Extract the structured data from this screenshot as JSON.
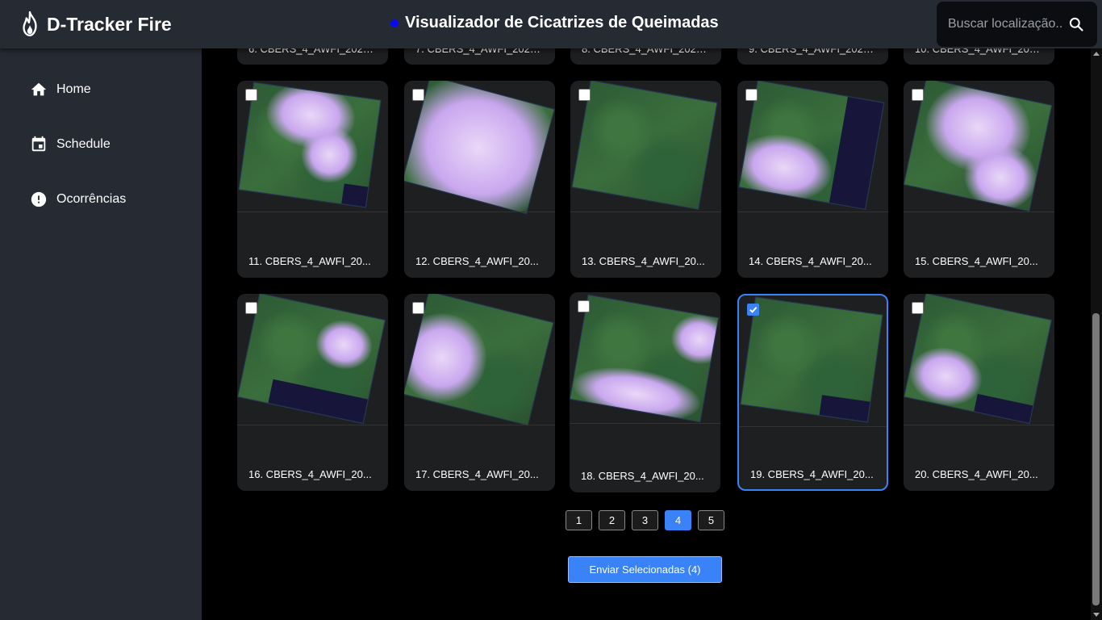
{
  "app": {
    "title": "D-Tracker Fire"
  },
  "header": {
    "page_title": "Visualizador de Cicatrizes de Queimadas",
    "status_dot_color": "#0a0af0"
  },
  "search": {
    "placeholder": "Buscar localização...",
    "value": ""
  },
  "sidebar": {
    "items": [
      {
        "label": "Home",
        "icon": "home-icon"
      },
      {
        "label": "Schedule",
        "icon": "calendar-icon"
      },
      {
        "label": "Ocorrências",
        "icon": "alert-icon"
      }
    ]
  },
  "images": {
    "partial_row": [
      {
        "label": "6. CBERS_4_AWFI_202…"
      },
      {
        "label": "7. CBERS_4_AWFI_202…"
      },
      {
        "label": "8. CBERS_4_AWFI_202…"
      },
      {
        "label": "9. CBERS_4_AWFI_202…"
      },
      {
        "label": "10. CBERS_4_AWFI_20…"
      }
    ],
    "cards": [
      {
        "label": "11. CBERS_4_AWFI_20...",
        "selected": false
      },
      {
        "label": "12. CBERS_4_AWFI_20...",
        "selected": false
      },
      {
        "label": "13. CBERS_4_AWFI_20...",
        "selected": false
      },
      {
        "label": "14. CBERS_4_AWFI_20...",
        "selected": false
      },
      {
        "label": "15. CBERS_4_AWFI_20...",
        "selected": false
      },
      {
        "label": "16. CBERS_4_AWFI_20...",
        "selected": false
      },
      {
        "label": "17. CBERS_4_AWFI_20...",
        "selected": false
      },
      {
        "label": "18. CBERS_4_AWFI_20...",
        "selected": false
      },
      {
        "label": "19. CBERS_4_AWFI_20...",
        "selected": true
      },
      {
        "label": "20. CBERS_4_AWFI_20...",
        "selected": false
      }
    ]
  },
  "pagination": {
    "pages": [
      "1",
      "2",
      "3",
      "4",
      "5"
    ],
    "current": "4"
  },
  "actions": {
    "send_label": "Enviar Selecionadas (4)"
  },
  "colors": {
    "accent": "#3a82f7",
    "panel": "#262a33",
    "card": "#1e1f21"
  }
}
